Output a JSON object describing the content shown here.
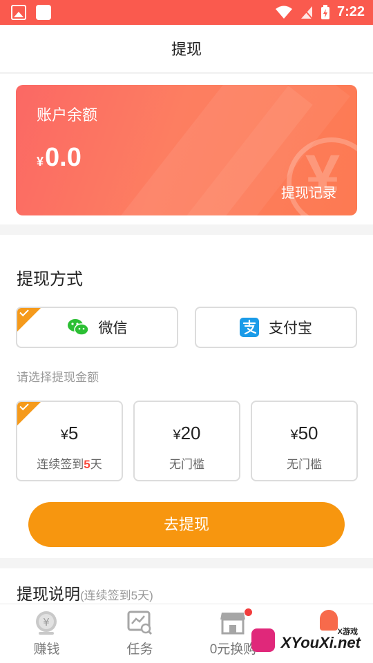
{
  "status_bar": {
    "time": "7:22"
  },
  "header": {
    "title": "提现"
  },
  "balance": {
    "label": "账户余额",
    "currency": "¥",
    "amount": "0.0",
    "history_link": "提现记录"
  },
  "method": {
    "title": "提现方式",
    "options": [
      {
        "label": "微信",
        "icon": "wechat-icon",
        "selected": true
      },
      {
        "label": "支付宝",
        "icon": "alipay-icon",
        "selected": false
      }
    ]
  },
  "amounts": {
    "hint": "请选择提现金额",
    "currency": "¥",
    "options": [
      {
        "value": "5",
        "note_prefix": "连续签到",
        "note_highlight": "5",
        "note_suffix": "天",
        "selected": true
      },
      {
        "value": "20",
        "note": "无门槛",
        "selected": false
      },
      {
        "value": "50",
        "note": "无门槛",
        "selected": false
      }
    ]
  },
  "submit_label": "去提现",
  "notes": {
    "title": "提现说明",
    "subtitle": "(连续签到5天)"
  },
  "bottom_nav": [
    {
      "label": "赚钱",
      "icon": "coin-icon"
    },
    {
      "label": "任务",
      "icon": "task-icon"
    },
    {
      "label": "0元换购",
      "icon": "store-icon",
      "badge": true
    },
    {
      "label": "",
      "icon": "profile-icon"
    }
  ],
  "watermark": {
    "top": "X游戏",
    "main": "XYouXi.net"
  },
  "colors": {
    "primary": "#fa5a4e",
    "accent": "#f7960f",
    "highlight": "#fa4a3c"
  }
}
